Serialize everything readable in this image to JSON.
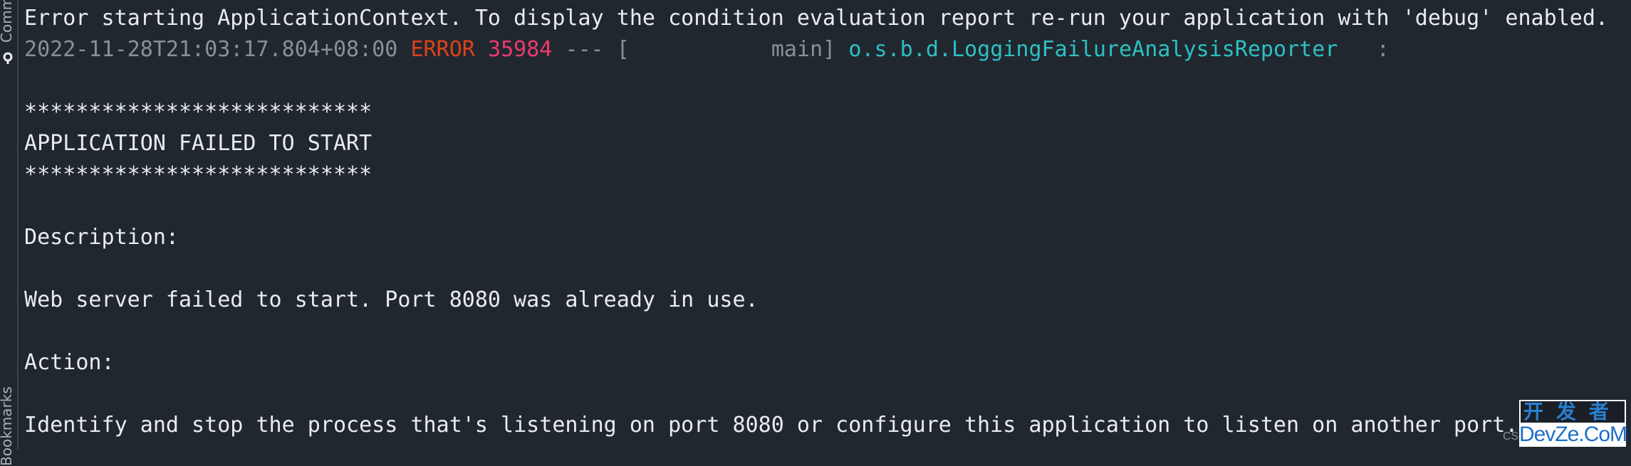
{
  "sidebar": {
    "tabs": [
      {
        "label": "Commit",
        "icon": "commit-icon"
      },
      {
        "label": "Bookmarks"
      }
    ]
  },
  "console": {
    "header_line": "Error starting ApplicationContext. To display the condition evaluation report re-run your application with 'debug' enabled.",
    "log_entry": {
      "timestamp": "2022-11-28T21:03:17.804+08:00",
      "level": "ERROR",
      "pid": "35984",
      "separator": "---",
      "thread": "[           main]",
      "logger": "o.s.b.d.LoggingFailureAnalysisReporter",
      "colon": ":"
    },
    "banner_border": "***************************",
    "banner_title": "APPLICATION FAILED TO START",
    "description_label": "Description:",
    "description_text": "Web server failed to start. Port 8080 was already in use.",
    "action_label": "Action:",
    "action_text": "Identify and stop the process that's listening on port 8080 or configure this application to listen on another port."
  },
  "colors": {
    "background": "#21272f",
    "text": "#e9ecef",
    "timestamp": "#8b9098",
    "level_error": "#dd4216",
    "pid": "#ea3a6e",
    "logger": "#2cc1c4"
  },
  "watermark": {
    "top": "开发者",
    "bottom": "DevZe.CoM",
    "prefix": "CS"
  }
}
